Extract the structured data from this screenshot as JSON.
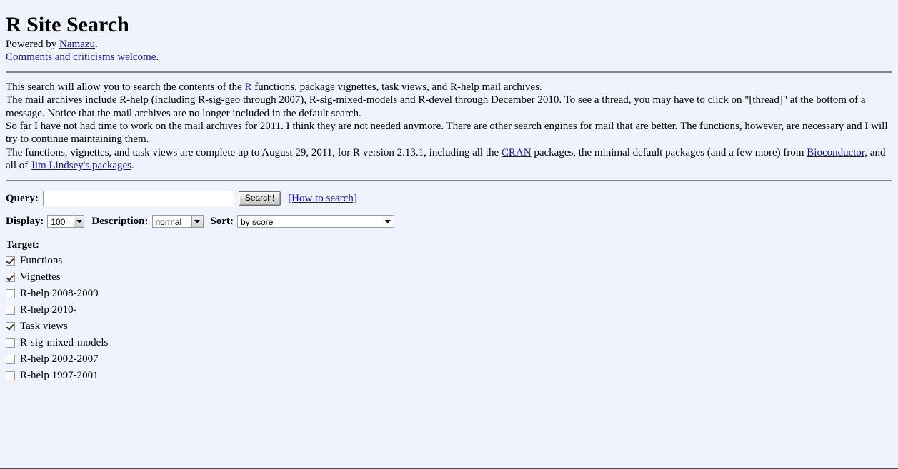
{
  "header": {
    "title": "R Site Search",
    "powered_prefix": "Powered by ",
    "powered_link": "Namazu",
    "powered_suffix": ".",
    "comments_link": "Comments and criticisms welcome",
    "comments_suffix": "."
  },
  "intro": {
    "p1_a": "This search will allow you to search the contents of the ",
    "p1_link": "R",
    "p1_b": " functions, package vignettes, task views, and R-help mail archives.",
    "p2": "The mail archives include R-help (including R-sig-geo through 2007), R-sig-mixed-models and R-devel through December 2010. To see a thread, you may have to click on \"[thread]\" at the bottom of a message. Notice that the mail archives are no longer included in the default search.",
    "p3": "So far I have not had time to work on the mail archives for 2011. I think they are not needed anymore. There are other search engines for mail that are better. The functions, however, are necessary and I will try to continue maintaining them.",
    "p4_a": "The functions, vignettes, and task views are complete up to August 29, 2011, for R version 2.13.1, including all the ",
    "p4_link1": "CRAN",
    "p4_b": " packages, the minimal default packages (and a few more) from ",
    "p4_link2": "Bioconductor",
    "p4_c": ", and all of ",
    "p4_link3": "Jim Lindsey's packages",
    "p4_d": "."
  },
  "form": {
    "query_label": "Query:",
    "query_value": "",
    "query_placeholder": "",
    "search_button": "Search!",
    "howto_link": "[How to search]",
    "display_label": "Display:",
    "display_value": "100",
    "description_label": "Description:",
    "description_value": "normal",
    "sort_label": "Sort:",
    "sort_value": "by score"
  },
  "target": {
    "title": "Target:",
    "items": [
      {
        "label": "Functions",
        "checked": true
      },
      {
        "label": "Vignettes",
        "checked": true
      },
      {
        "label": "R-help 2008-2009",
        "checked": false
      },
      {
        "label": "R-help 2010-",
        "checked": false
      },
      {
        "label": "Task views",
        "checked": true
      },
      {
        "label": "R-sig-mixed-models",
        "checked": false
      },
      {
        "label": "R-help 2002-2007",
        "checked": false
      },
      {
        "label": "R-help 1997-2001",
        "checked": false
      }
    ]
  },
  "colors": {
    "background": "#eef3fd",
    "link": "#1111cc",
    "rule": "#7f8795",
    "text": "#000000"
  }
}
